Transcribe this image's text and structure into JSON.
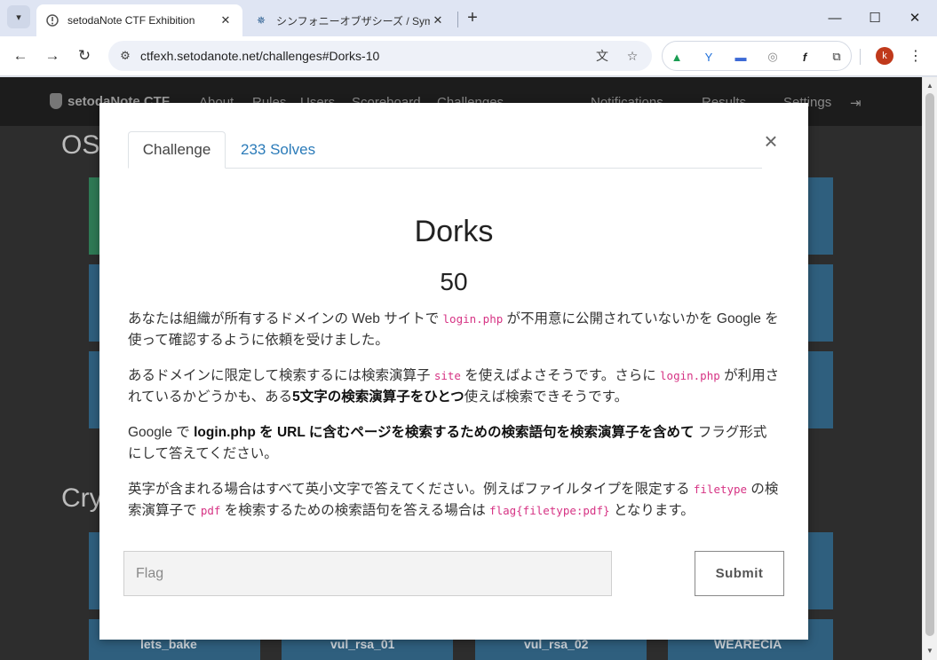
{
  "browser": {
    "tabs": [
      {
        "title": "setodaNote CTF Exhibition",
        "active": true,
        "favicon": "setodanote-favicon"
      },
      {
        "title": "シンフォニーオブザシーズ / Symphon",
        "active": false,
        "favicon": "ship-wheel-favicon"
      }
    ],
    "url": "ctfexh.setodanote.net/challenges#Dorks-10",
    "profile_initial": "k",
    "extensions": [
      "google-drive-icon",
      "extension-y-icon",
      "chat-icon",
      "compass-icon",
      "script-icon"
    ]
  },
  "site": {
    "brand": "setodaNote CTF",
    "nav_left": [
      "About",
      "Rules",
      "Users",
      "Scoreboard",
      "Challenges"
    ],
    "nav_right": [
      "Notifications",
      "Results",
      "Settings"
    ],
    "sections": [
      "OSI",
      "Cry"
    ],
    "bottom_cards": [
      "lets_bake",
      "vul_rsa_01",
      "vul_rsa_02",
      "WEARECIA"
    ]
  },
  "modal": {
    "tab_challenge": "Challenge",
    "tab_solves": "233 Solves",
    "close": "×",
    "name": "Dorks",
    "value": "50",
    "description": {
      "p1": {
        "t1": "あなたは組織が所有するドメインの Web サイトで ",
        "c1": "login.php",
        "t2": " が不用意に公開されていないかを Google を使って確認するように依頼を受けました。"
      },
      "p2": {
        "t1": "あるドメインに限定して検索するには検索演算子 ",
        "c1": "site",
        "t2": " を使えばよさそうです。さらに ",
        "c2": "login.php",
        "t3": " が利用されているかどうかも、ある",
        "b1": "5文字の検索演算子をひとつ",
        "t4": "使えば検索できそうです。"
      },
      "p3": {
        "t1": "Google で ",
        "b1": "login.php を URL に含むページを検索するための検索語句を検索演算子を含めて",
        "t2": " フラグ形式にして答えてください。"
      },
      "p4": {
        "t1": "英字が含まれる場合はすべて英小文字で答えてください。例えばファイルタイプを限定する ",
        "c1": "filetype",
        "t2": " の検索演算子で ",
        "c2": "pdf",
        "t3": " を検索するための検索語句を答える場合は ",
        "c3": "flag{filetype:pdf}",
        "t4": " となります。"
      }
    },
    "flag_placeholder": "Flag",
    "submit_label": "Submit"
  }
}
